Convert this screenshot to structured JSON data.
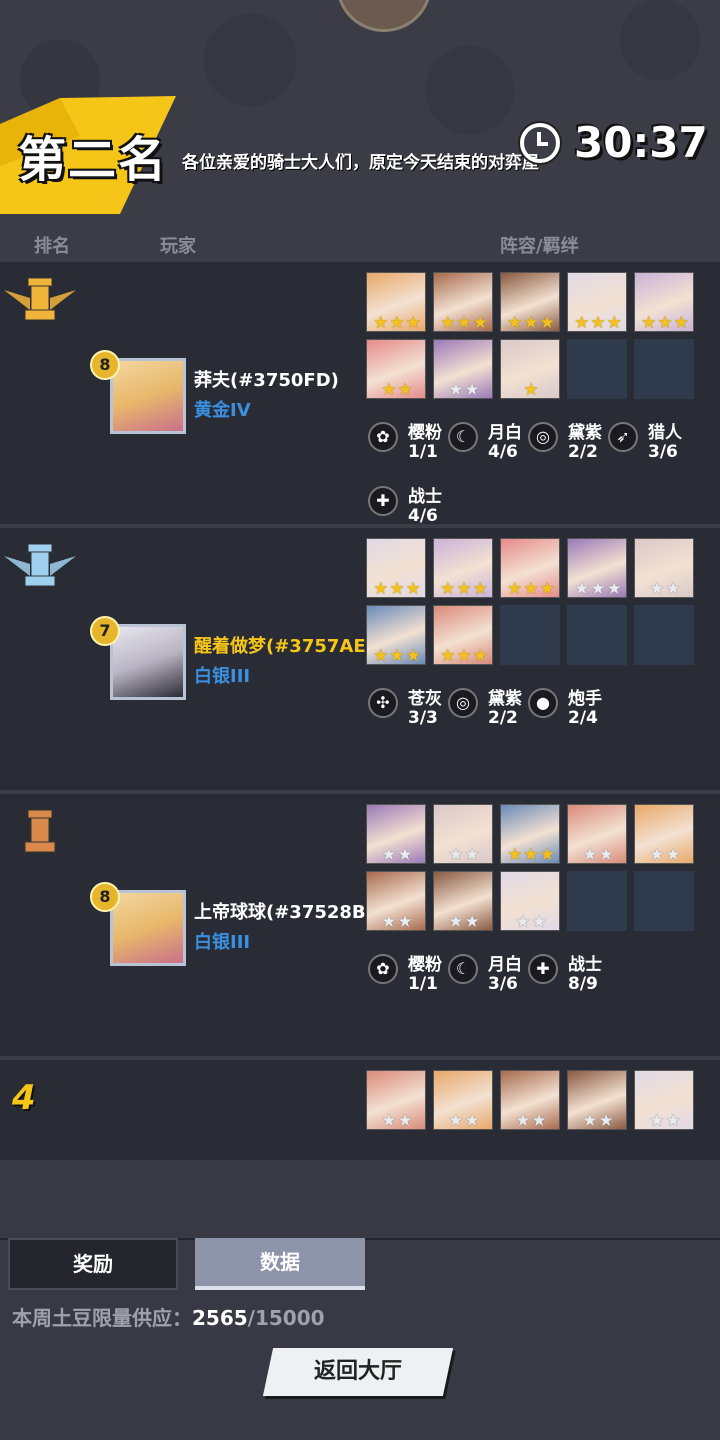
{
  "header": {
    "rank_title": "第二名",
    "ticker": "各位亲爱的骑士大人们，原定今天结束的对弈屋",
    "timer": "30:37"
  },
  "columns": {
    "rank": "排名",
    "player": "玩家",
    "lineup": "阵容/羁绊"
  },
  "colors": {
    "gold_star": "#f4c21f",
    "silver_star": "#e8ebf0",
    "tier_blue": "#3a8fe0",
    "name_gold": "#f5c518"
  },
  "rows": [
    {
      "rank_icon": "gold-rook-winged-icon",
      "level": "8",
      "name": "莽夫(#3750FD)",
      "name_color": "#ffffff",
      "tier": "黄金IV",
      "units": [
        {
          "stars": 3,
          "tone": "gold"
        },
        {
          "stars": 3,
          "tone": "gold"
        },
        {
          "stars": 3,
          "tone": "gold"
        },
        {
          "stars": 3,
          "tone": "gold"
        },
        {
          "stars": 3,
          "tone": "gold"
        },
        {
          "stars": 2,
          "tone": "gold"
        },
        {
          "stars": 2,
          "tone": "silver"
        },
        {
          "stars": 1,
          "tone": "gold"
        },
        {
          "stars": 0,
          "tone": "empty"
        },
        {
          "stars": 0,
          "tone": "empty"
        }
      ],
      "traits": [
        {
          "icon": "sakura-icon",
          "glyph": "✿",
          "name": "樱粉",
          "count": "1/1"
        },
        {
          "icon": "moon-icon",
          "glyph": "☾",
          "name": "月白",
          "count": "4/6"
        },
        {
          "icon": "swirl-icon",
          "glyph": "◎",
          "name": "黛紫",
          "count": "2/2"
        },
        {
          "icon": "bow-icon",
          "glyph": "➶",
          "name": "猎人",
          "count": "3/6"
        },
        {
          "icon": "warrior-icon",
          "glyph": "✚",
          "name": "战士",
          "count": "4/6"
        }
      ]
    },
    {
      "rank_icon": "silver-rook-winged-icon",
      "level": "7",
      "name": "醒着做梦(#3757AE)",
      "name_color": "#f5c518",
      "tier": "白银III",
      "units": [
        {
          "stars": 3,
          "tone": "gold"
        },
        {
          "stars": 3,
          "tone": "gold"
        },
        {
          "stars": 3,
          "tone": "gold"
        },
        {
          "stars": 3,
          "tone": "silver"
        },
        {
          "stars": 2,
          "tone": "silver"
        },
        {
          "stars": 3,
          "tone": "gold"
        },
        {
          "stars": 3,
          "tone": "gold"
        },
        {
          "stars": 0,
          "tone": "empty"
        },
        {
          "stars": 0,
          "tone": "empty"
        },
        {
          "stars": 0,
          "tone": "empty"
        }
      ],
      "traits": [
        {
          "icon": "ash-icon",
          "glyph": "✣",
          "name": "苍灰",
          "count": "3/3"
        },
        {
          "icon": "swirl-icon",
          "glyph": "◎",
          "name": "黛紫",
          "count": "2/2"
        },
        {
          "icon": "cannon-icon",
          "glyph": "●",
          "name": "炮手",
          "count": "2/4"
        }
      ]
    },
    {
      "rank_icon": "bronze-rook-icon",
      "level": "8",
      "name": "上帝球球(#37528B)",
      "name_color": "#ffffff",
      "tier": "白银III",
      "units": [
        {
          "stars": 2,
          "tone": "silver"
        },
        {
          "stars": 2,
          "tone": "silver"
        },
        {
          "stars": 3,
          "tone": "gold"
        },
        {
          "stars": 2,
          "tone": "silver"
        },
        {
          "stars": 2,
          "tone": "silver"
        },
        {
          "stars": 2,
          "tone": "silver"
        },
        {
          "stars": 2,
          "tone": "silver"
        },
        {
          "stars": 2,
          "tone": "silver"
        },
        {
          "stars": 0,
          "tone": "empty"
        },
        {
          "stars": 0,
          "tone": "empty"
        }
      ],
      "traits": [
        {
          "icon": "sakura-icon",
          "glyph": "✿",
          "name": "樱粉",
          "count": "1/1"
        },
        {
          "icon": "moon-icon",
          "glyph": "☾",
          "name": "月白",
          "count": "3/6"
        },
        {
          "icon": "warrior-icon",
          "glyph": "✚",
          "name": "战士",
          "count": "8/9"
        }
      ]
    },
    {
      "rank_number": "4",
      "units": [
        {
          "stars": 2,
          "tone": "silver"
        },
        {
          "stars": 2,
          "tone": "silver"
        },
        {
          "stars": 2,
          "tone": "silver"
        },
        {
          "stars": 2,
          "tone": "silver"
        },
        {
          "stars": 2,
          "tone": "silver"
        }
      ]
    }
  ],
  "tabs": [
    {
      "label": "奖励",
      "active": false
    },
    {
      "label": "数据",
      "active": true
    }
  ],
  "supply": {
    "label": "本周土豆限量供应：",
    "current": "2565",
    "total": "/15000"
  },
  "back_button": "返回大厅"
}
